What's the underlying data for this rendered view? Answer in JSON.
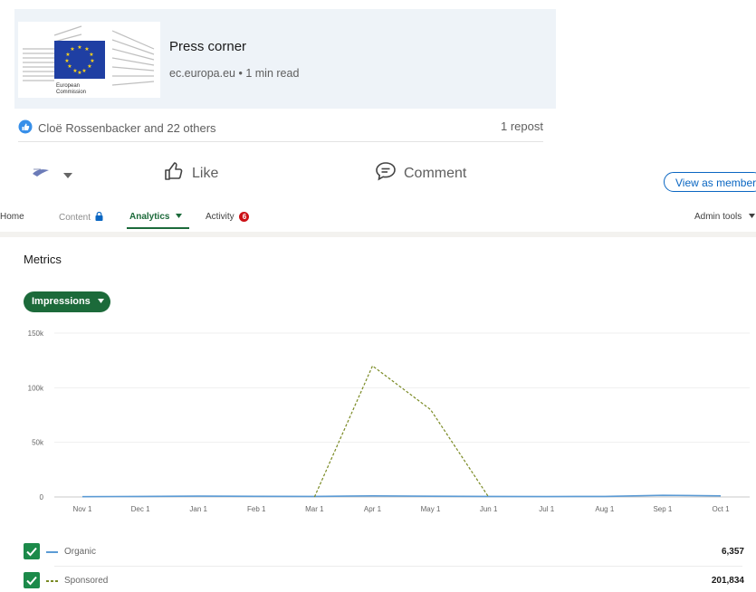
{
  "article": {
    "title": "Press corner",
    "source": "ec.europa.eu",
    "separator": "•",
    "read_time": "1 min read",
    "logo_text_line1": "European",
    "logo_text_line2": "Commission"
  },
  "social": {
    "reactions_text": "Cloë Rossenbacker and 22 others",
    "reposts_text": "1 repost"
  },
  "actions": {
    "like_label": "Like",
    "comment_label": "Comment",
    "view_as_member_label": "View as member"
  },
  "nav": {
    "tabs": [
      {
        "label": "Home"
      },
      {
        "label": "Content"
      },
      {
        "label": "Analytics",
        "active": true
      },
      {
        "label": "Activity",
        "badge": "6"
      }
    ],
    "admin_tools_label": "Admin tools"
  },
  "metrics": {
    "title": "Metrics",
    "dropdown_label": "Impressions"
  },
  "chart_data": {
    "type": "line",
    "x": [
      "Nov 1",
      "Dec 1",
      "Jan 1",
      "Feb 1",
      "Mar 1",
      "Apr 1",
      "May 1",
      "Jun 1",
      "Jul 1",
      "Aug 1",
      "Sep 1",
      "Oct 1"
    ],
    "yticks": [
      "150k",
      "100k",
      "50k",
      "0"
    ],
    "ylim": [
      0,
      150000
    ],
    "grid": true,
    "series": [
      {
        "name": "Organic",
        "color": "#5b9bd5",
        "dashed": false,
        "values": [
          300,
          500,
          800,
          600,
          500,
          1000,
          700,
          500,
          400,
          500,
          1500,
          1000
        ]
      },
      {
        "name": "Sponsored",
        "color": "#7a8a24",
        "dashed": true,
        "values": [
          null,
          null,
          null,
          null,
          0,
          120000,
          80000,
          0,
          null,
          null,
          null,
          null
        ]
      }
    ]
  },
  "legend": [
    {
      "name": "Organic",
      "total": "6,357"
    },
    {
      "name": "Sponsored",
      "total": "201,834"
    }
  ],
  "colors": {
    "analytics_green": "#1c6a3a",
    "checkbox_green": "#1c8a4a",
    "link_blue": "#0a66c2",
    "badge_red": "#cc1016"
  }
}
